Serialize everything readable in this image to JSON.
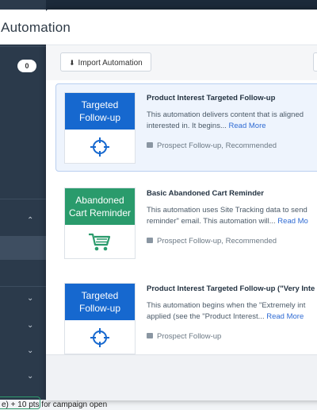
{
  "background": {
    "badge_count": "0",
    "footer_text": "e) + 10 pts for campaign open"
  },
  "modal": {
    "title": "Add an Automation",
    "import_button": "Import Automation"
  },
  "automations": [
    {
      "thumb_label": "Targeted Follow-up",
      "thumb_color": "#1668cf",
      "icon": "crosshair-icon",
      "title": "Product Interest Targeted Follow-up",
      "description": "This automation delivers content that is aligned interested in. It begins...",
      "read_more": "Read More",
      "tags": "Prospect Follow-up, Recommended"
    },
    {
      "thumb_label": "Abandoned Cart Reminder",
      "thumb_color": "#2a9b6c",
      "icon": "shopping-cart-icon",
      "title": "Basic Abandoned Cart Reminder",
      "description": "This automation uses Site Tracking data to send reminder\" email. This automation will...",
      "read_more": "Read Mo",
      "tags": "Prospect Follow-up, Recommended"
    },
    {
      "thumb_label": "Targeted Follow-up",
      "thumb_color": "#1668cf",
      "icon": "crosshair-icon",
      "title": "Product Interest Targeted Follow-up (\"Very Inte",
      "description": "This automation begins when the \"Extremely int applied (see the \"Product Interest...",
      "read_more": "Read More",
      "tags": "Prospect Follow-up"
    }
  ]
}
